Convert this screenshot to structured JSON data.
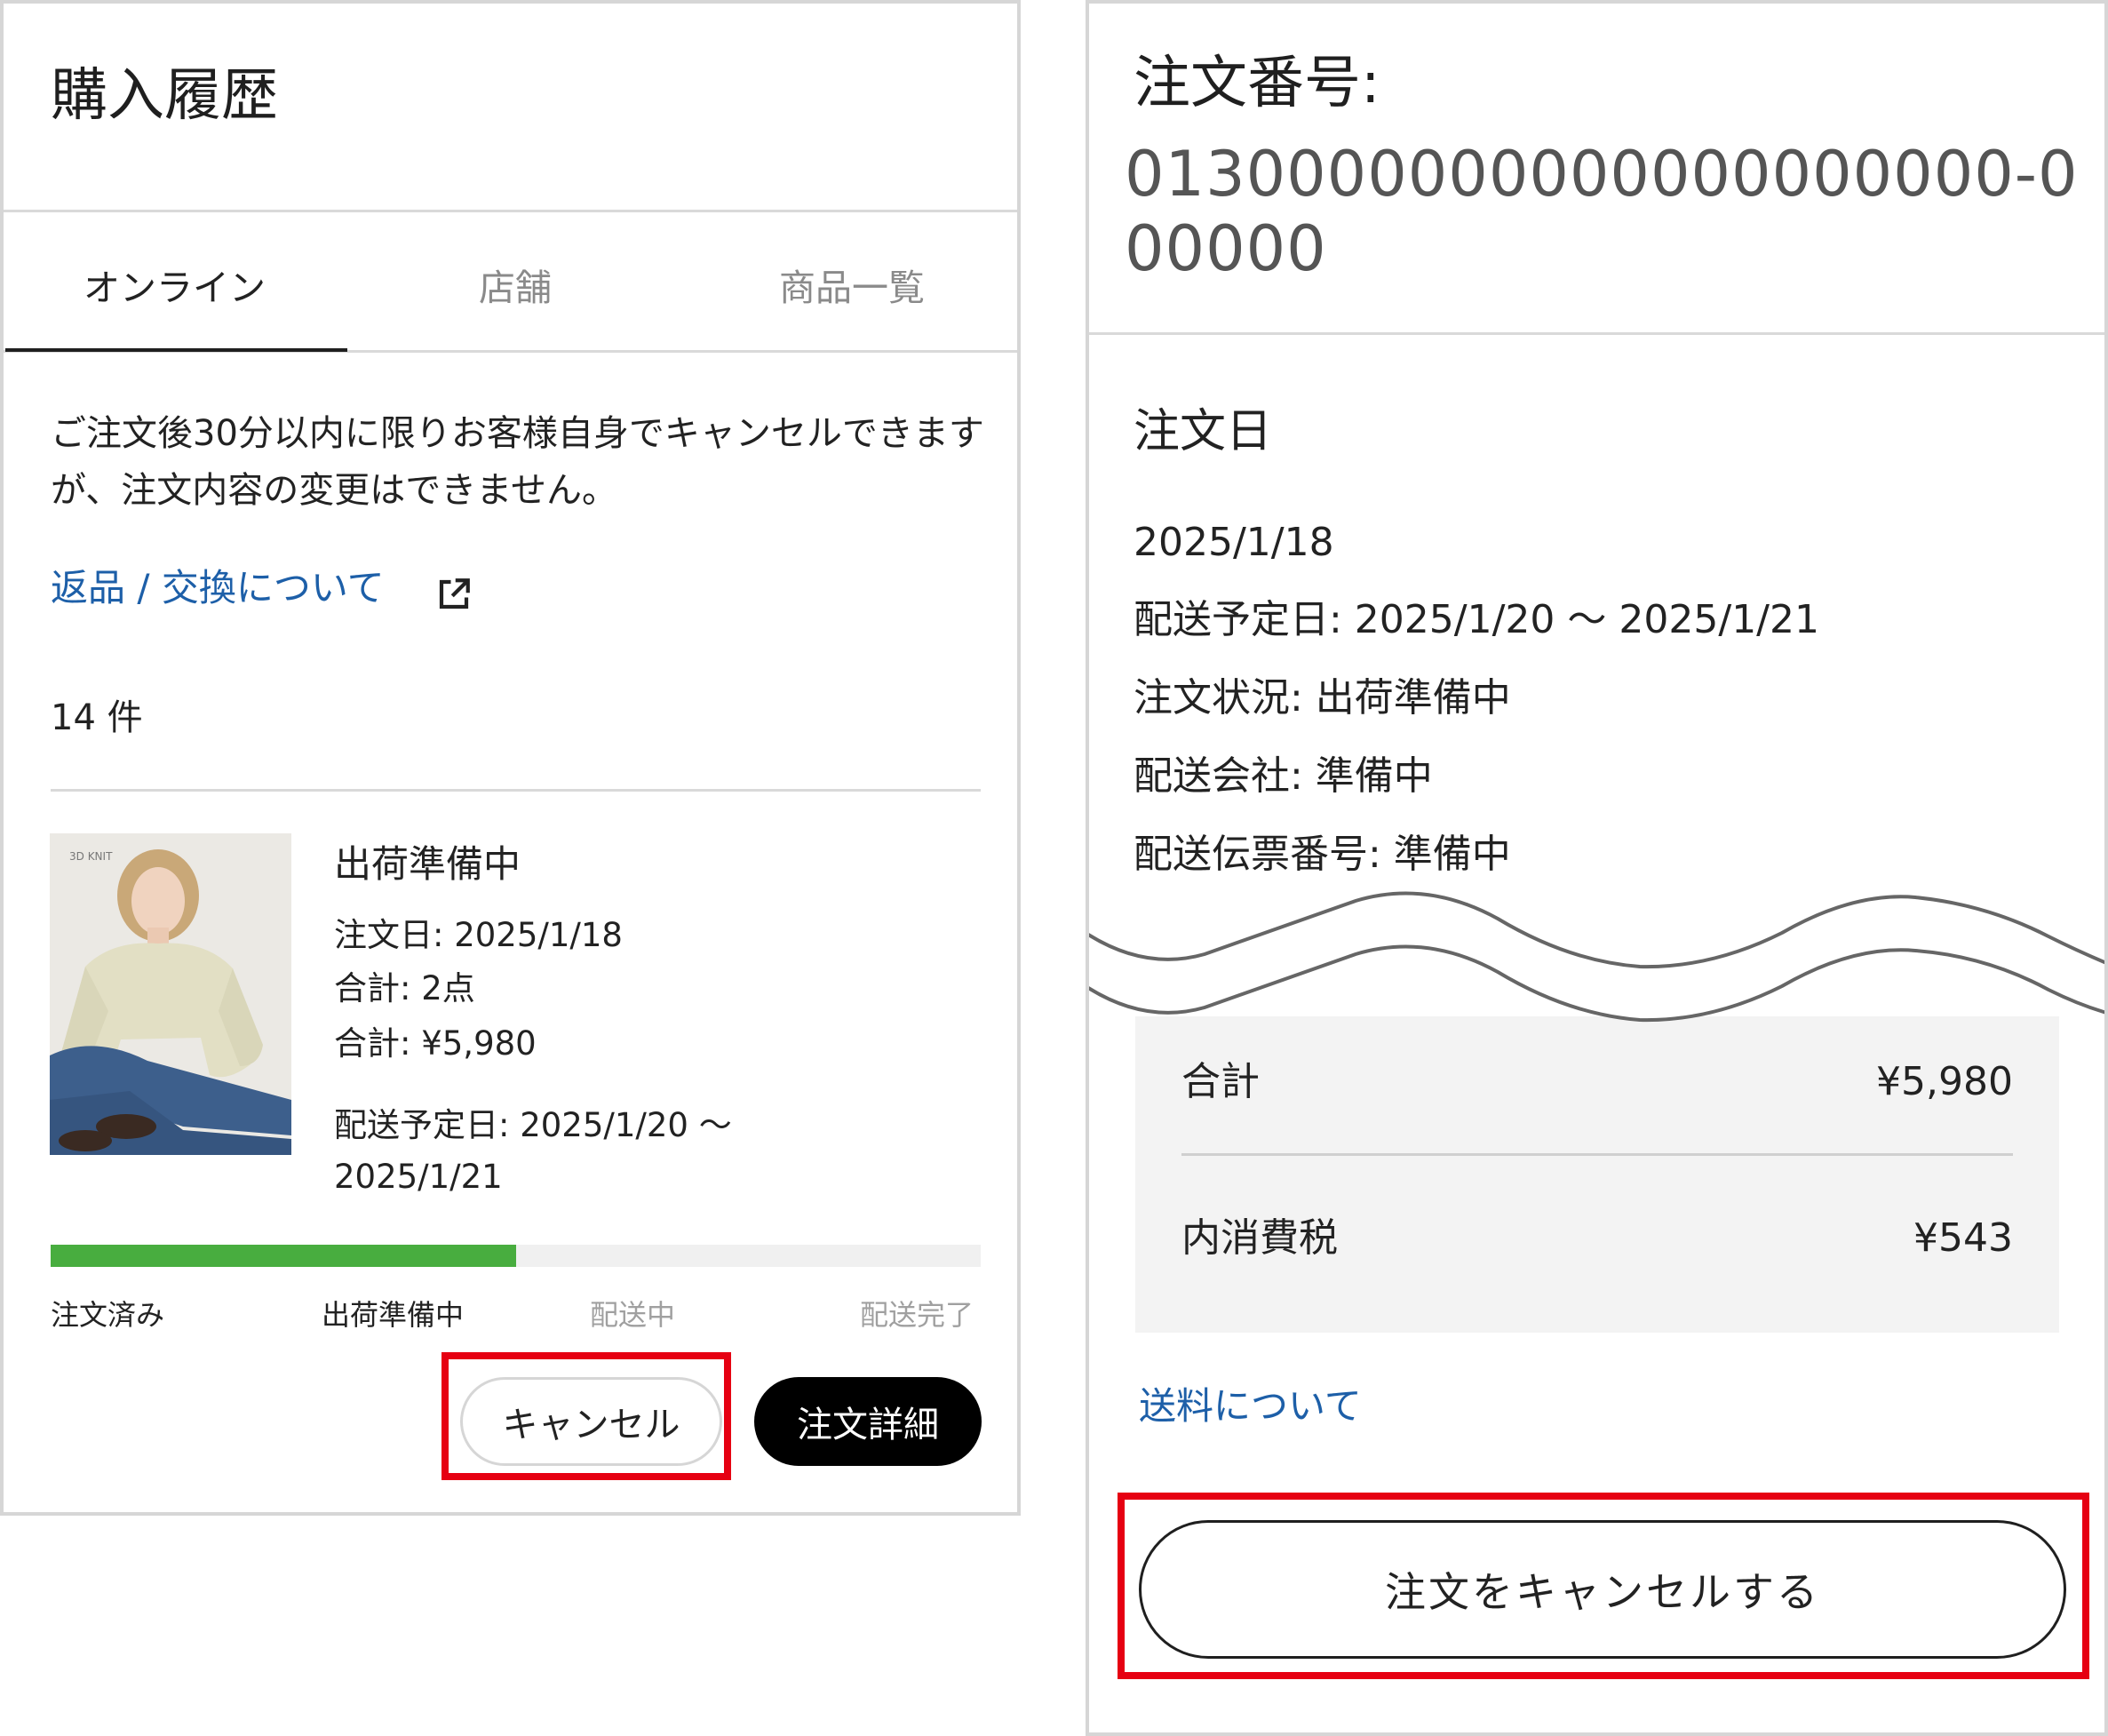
{
  "left": {
    "title": "購入履歴",
    "tabs": [
      {
        "label": "オンライン",
        "active": true
      },
      {
        "label": "店舗",
        "active": false
      },
      {
        "label": "商品一覧",
        "active": false
      }
    ],
    "notice": "ご注文後30分以内に限りお客様自身でキャンセルできますが、注文内容の変更はできません。",
    "return_link": "返品 / 交換について",
    "count": "14 件",
    "order": {
      "status": "出荷準備中",
      "order_date": "注文日: 2025/1/18",
      "quantity": "合計: 2点",
      "total": "合計: ¥5,980",
      "delivery_line1": "配送予定日: 2025/1/20 〜",
      "delivery_line2": "2025/1/21",
      "image_badge": "3D KNIT"
    },
    "progress": {
      "fraction": 0.5,
      "steps": [
        {
          "label": "注文済み",
          "done": true
        },
        {
          "label": "出荷準備中",
          "done": true
        },
        {
          "label": "配送中",
          "done": false
        },
        {
          "label": "配送完了",
          "done": false
        }
      ]
    },
    "cancel_label": "キャンセル",
    "detail_label": "注文詳細"
  },
  "right": {
    "order_number_label": "注文番号:",
    "order_number_value": "0130000000000000000000-000000",
    "order_date_label": "注文日",
    "order_date_value": "2025/1/18",
    "delivery": "配送予定日: 2025/1/20 〜 2025/1/21",
    "status": "注文状況: 出荷準備中",
    "carrier": "配送会社: 準備中",
    "tracking": "配送伝票番号: 準備中",
    "summary": {
      "total_label": "合計",
      "total_value": "¥5,980",
      "tax_label": "内消費税",
      "tax_value": "¥543"
    },
    "shipping_link": "送料について",
    "cancel_order_label": "注文をキャンセルする"
  },
  "colors": {
    "accent_green": "#48ad3f",
    "link_blue": "#1d5fa8",
    "highlight_red": "#e60012"
  }
}
